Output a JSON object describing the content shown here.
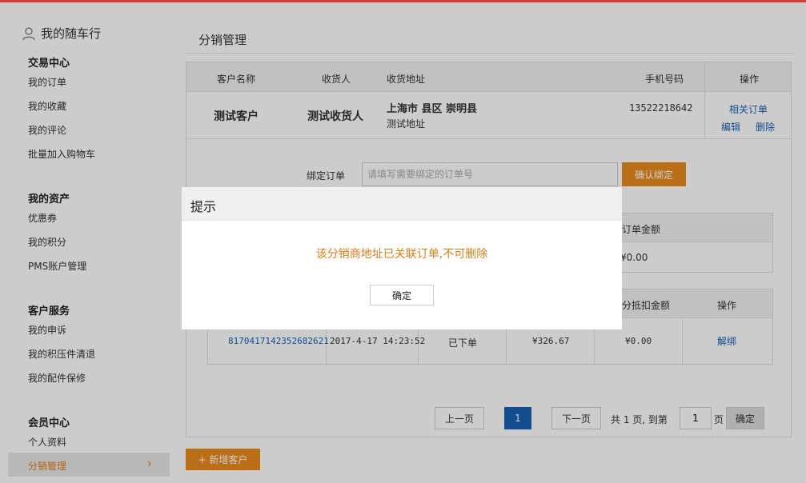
{
  "sidebar": {
    "title": "我的随车行",
    "groups": [
      {
        "label": "交易中心",
        "items": [
          "我的订单",
          "我的收藏",
          "我的评论",
          "批量加入购物车"
        ]
      },
      {
        "label": "我的资产",
        "items": [
          "优惠券",
          "我的积分",
          "PMS账户管理"
        ]
      },
      {
        "label": "客户服务",
        "items": [
          "我的申诉",
          "我的积压件清退",
          "我的配件保修"
        ]
      },
      {
        "label": "会员中心",
        "items": [
          "个人资料",
          "分销管理"
        ]
      }
    ],
    "active_item": "分销管理"
  },
  "main": {
    "page_title": "分销管理",
    "customer_table": {
      "headers": [
        "客户名称",
        "收货人",
        "收货地址",
        "手机号码",
        "操作"
      ],
      "row": {
        "customer_name": "测试客户",
        "receiver": "测试收货人",
        "address_line1": "上海市  县区  崇明县",
        "address_line2": "测试地址",
        "phone": "13522218642",
        "actions": [
          "相关订单",
          "编辑",
          "删除"
        ]
      }
    },
    "bind": {
      "label": "绑定订单",
      "placeholder": "请填写需要绑定的订单号",
      "button": "确认绑定"
    },
    "summary_table": {
      "header_visible": "订单金额",
      "value_visible": "¥0.00"
    },
    "order_table": {
      "headers_visible": [
        "分抵扣金额",
        "操作"
      ],
      "row": {
        "order_no": "8170417142352682621",
        "time": "2017-4-17 14:23:52",
        "status": "已下单",
        "amount": "¥326.67",
        "deduct": "¥0.00",
        "action": "解绑"
      }
    },
    "pager": {
      "prev": "上一页",
      "current": "1",
      "next": "下一页",
      "total_text": "共 1 页,  到第",
      "page_input": "1",
      "page_unit": "页",
      "go": "确定"
    },
    "add_button": "+ 新增客户"
  },
  "modal": {
    "title": "提示",
    "message": "该分销商地址已关联订单,不可删除",
    "ok": "确定"
  },
  "colors": {
    "accent_orange": "#e98b1d",
    "link_blue": "#1a5fb4",
    "top_bar_red": "#d93a3a"
  }
}
